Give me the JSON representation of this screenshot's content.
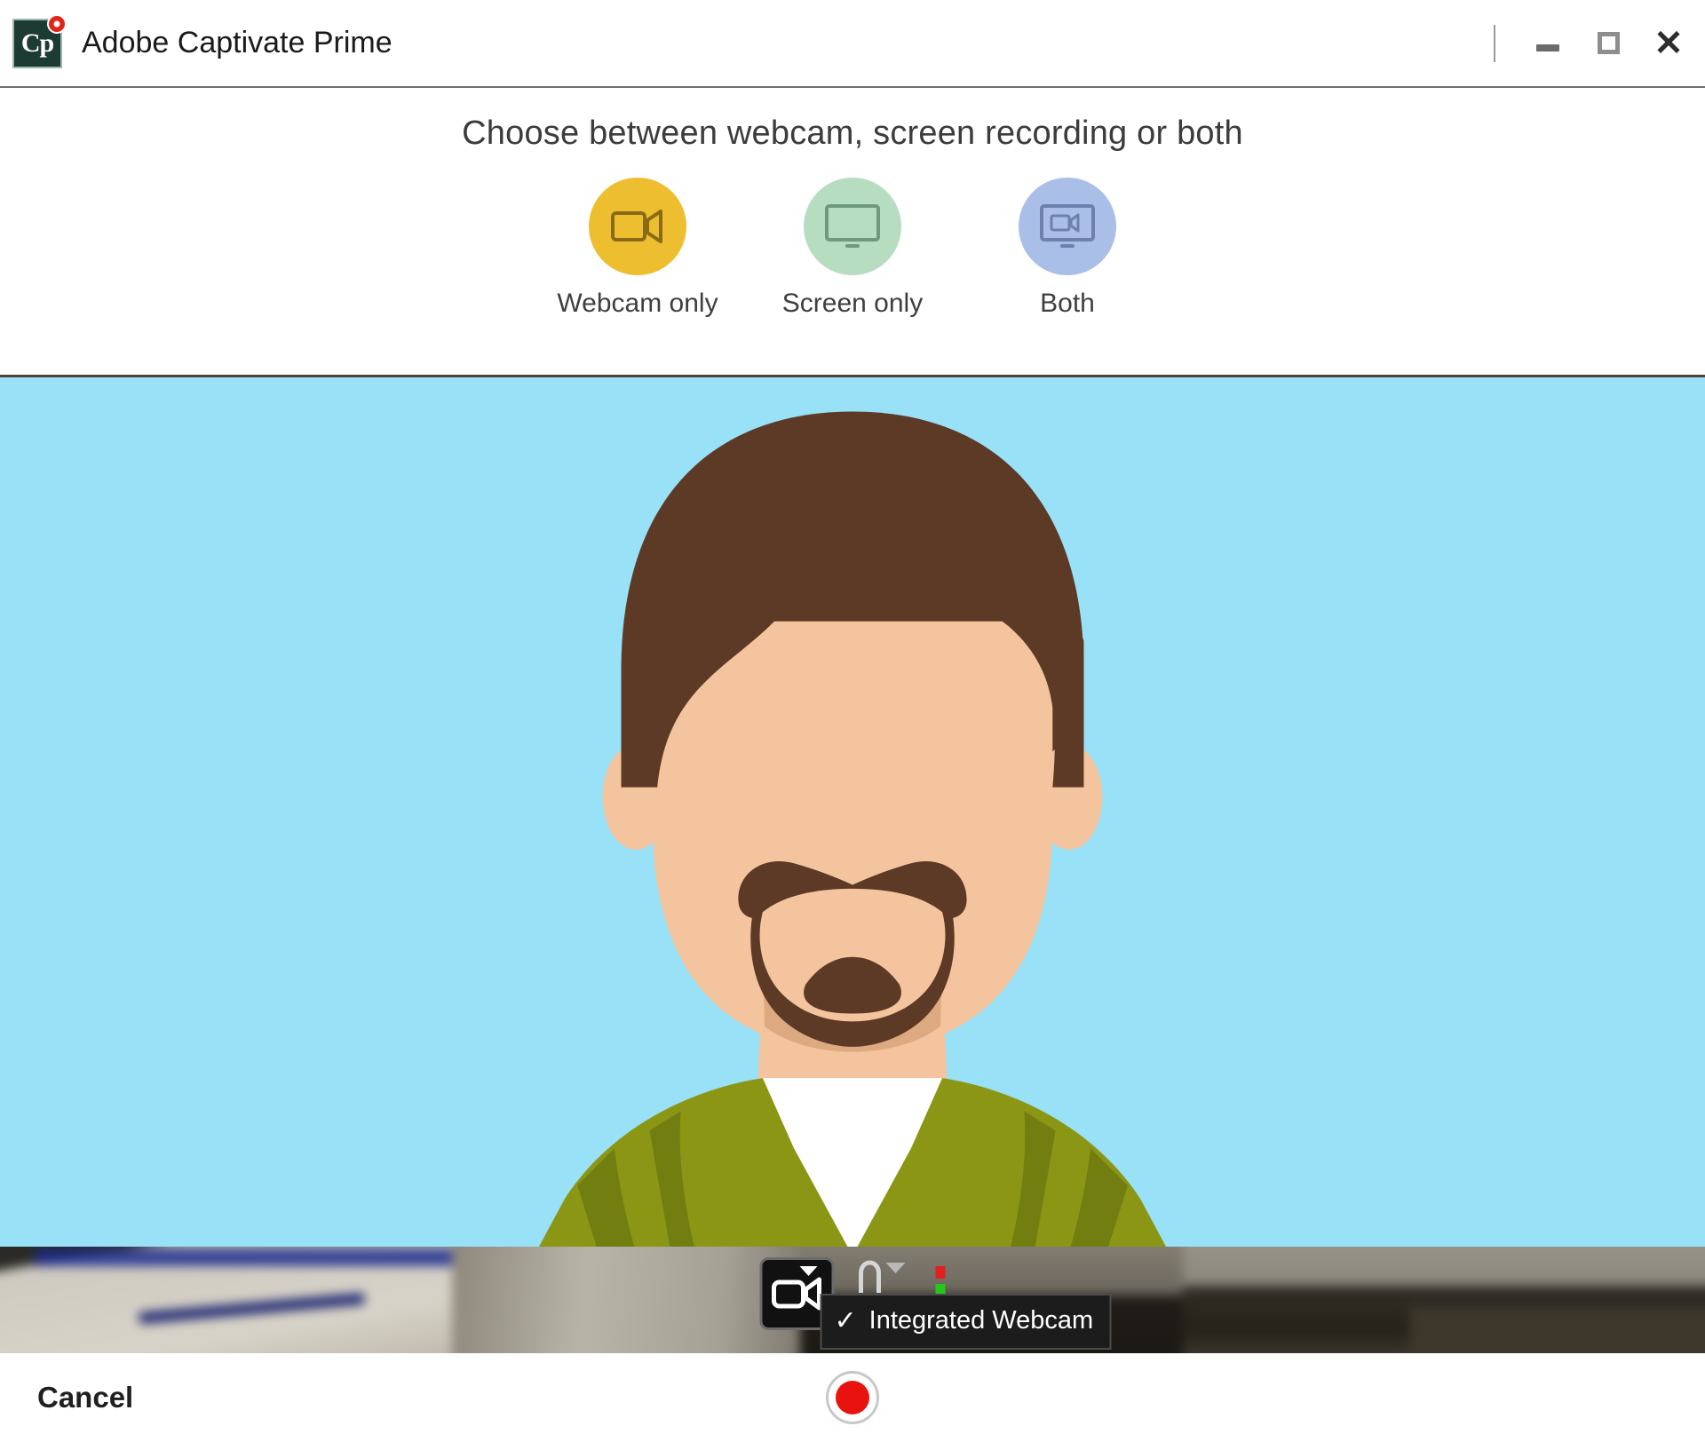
{
  "window": {
    "title": "Adobe Captivate Prime",
    "logo_text": "Cp",
    "controls": {
      "minimize_label": "Minimize",
      "maximize_label": "Maximize",
      "close_label": "Close",
      "close_glyph": "✕"
    }
  },
  "options_panel": {
    "heading": "Choose between webcam, screen recording or both",
    "modes": [
      {
        "label": "Webcam only",
        "icon": "video-camera-icon",
        "color": "#edbf30"
      },
      {
        "label": "Screen only",
        "icon": "monitor-icon",
        "color": "#b6ddbf"
      },
      {
        "label": "Both",
        "icon": "monitor-with-camera-icon",
        "color": "#a9bfe8"
      }
    ]
  },
  "preview": {
    "background_color": "#99e1f7",
    "avatar": {
      "hair_color": "#5d3a26",
      "skin_color": "#f3c49d",
      "skin_shadow_color": "#dda980",
      "beard_color": "#5d3a26",
      "jacket_color": "#8b9615",
      "jacket_shadow_color": "#6f7a10",
      "shirt_color": "#ffffff"
    }
  },
  "camera_toolbar": {
    "camera_button_icon": "video-camera-icon",
    "camera_dropdown_icon": "caret-down-icon",
    "microphone_icon": "microphone-icon",
    "microphone_dropdown_icon": "caret-down-icon",
    "status_indicator_red": "#e02020",
    "status_indicator_green": "#24c81c",
    "menu": {
      "check_glyph": "✓",
      "selected_device": "Integrated Webcam"
    }
  },
  "bottom_bar": {
    "cancel_label": "Cancel",
    "record_label": "Record",
    "record_color": "#e8130f"
  }
}
